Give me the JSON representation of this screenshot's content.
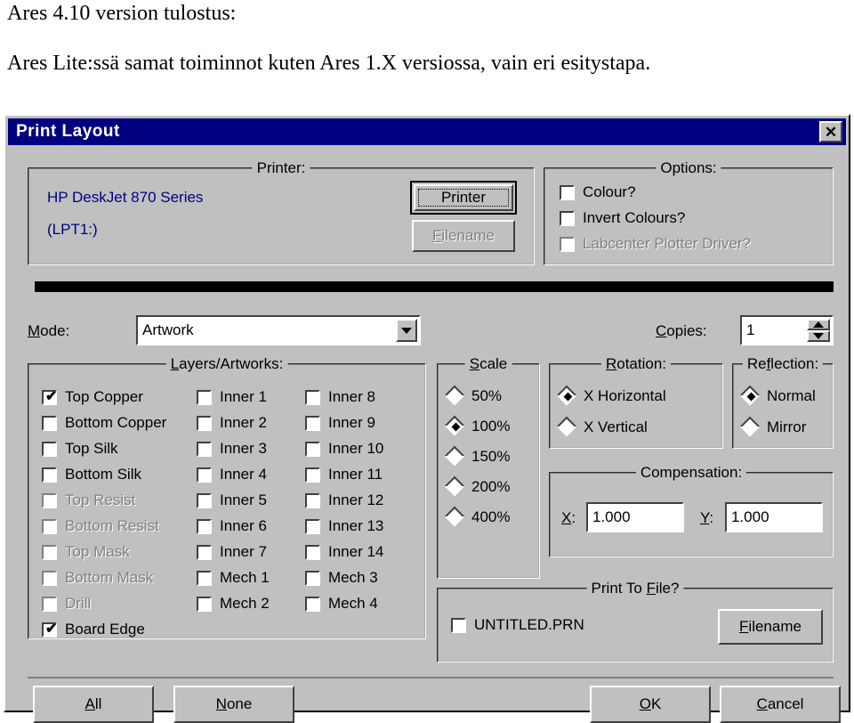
{
  "document": {
    "line1": "Ares 4.10 version tulostus:",
    "line2": "Ares Lite:ssä samat toiminnot kuten Ares 1.X versiossa, vain eri esitystapa."
  },
  "dialog": {
    "title": "Print Layout",
    "close_icon": "close-icon",
    "close_label": "✕",
    "colors": {
      "titlebar": "#000080",
      "face": "#c0c0c0",
      "printer_text": "#000080",
      "disabled_text": "#808080"
    },
    "printer_group": {
      "label": "Printer:",
      "name_line": "HP DeskJet 870 Series",
      "port_line": "(LPT1:)",
      "printer_button": "Printer",
      "filename_button": "Filename",
      "filename_button_accel": "F"
    },
    "options_group": {
      "label": "Options:",
      "items": [
        {
          "label": "Colour?",
          "checked": false,
          "disabled": false
        },
        {
          "label": "Invert Colours?",
          "checked": false,
          "disabled": false
        },
        {
          "label": "Labcenter Plotter Driver?",
          "checked": false,
          "disabled": true
        }
      ]
    },
    "mode_row": {
      "label": "Mode:",
      "label_accel": "M",
      "value": "Artwork",
      "options": [
        "Artwork"
      ]
    },
    "copies_row": {
      "label": "Copies:",
      "label_accel": "C",
      "value": "1"
    },
    "layers_group": {
      "label": "Layers/Artworks:",
      "label_accel": "L",
      "column1": [
        {
          "label": "Top Copper",
          "checked": true,
          "disabled": false
        },
        {
          "label": "Bottom Copper",
          "checked": false,
          "disabled": false
        },
        {
          "label": "Top Silk",
          "checked": false,
          "disabled": false
        },
        {
          "label": "Bottom Silk",
          "checked": false,
          "disabled": false
        },
        {
          "label": "Top Resist",
          "checked": false,
          "disabled": true
        },
        {
          "label": "Bottom Resist",
          "checked": false,
          "disabled": true
        },
        {
          "label": "Top Mask",
          "checked": false,
          "disabled": true
        },
        {
          "label": "Bottom Mask",
          "checked": false,
          "disabled": true
        },
        {
          "label": "Drill",
          "checked": false,
          "disabled": true
        },
        {
          "label": "Board Edge",
          "checked": true,
          "disabled": false
        }
      ],
      "column2": [
        {
          "label": "Inner 1",
          "checked": false,
          "disabled": false
        },
        {
          "label": "Inner 2",
          "checked": false,
          "disabled": false
        },
        {
          "label": "Inner 3",
          "checked": false,
          "disabled": false
        },
        {
          "label": "Inner 4",
          "checked": false,
          "disabled": false
        },
        {
          "label": "Inner 5",
          "checked": false,
          "disabled": false
        },
        {
          "label": "Inner 6",
          "checked": false,
          "disabled": false
        },
        {
          "label": "Inner 7",
          "checked": false,
          "disabled": false
        },
        {
          "label": "Mech 1",
          "checked": false,
          "disabled": false
        },
        {
          "label": "Mech 2",
          "checked": false,
          "disabled": false
        }
      ],
      "column3": [
        {
          "label": "Inner 8",
          "checked": false,
          "disabled": false
        },
        {
          "label": "Inner 9",
          "checked": false,
          "disabled": false
        },
        {
          "label": "Inner 10",
          "checked": false,
          "disabled": false
        },
        {
          "label": "Inner 11",
          "checked": false,
          "disabled": false
        },
        {
          "label": "Inner 12",
          "checked": false,
          "disabled": false
        },
        {
          "label": "Inner 13",
          "checked": false,
          "disabled": false
        },
        {
          "label": "Inner 14",
          "checked": false,
          "disabled": false
        },
        {
          "label": "Mech 3",
          "checked": false,
          "disabled": false
        },
        {
          "label": "Mech 4",
          "checked": false,
          "disabled": false
        }
      ],
      "all_button": "All",
      "all_button_accel": "A",
      "none_button": "None",
      "none_button_accel": "N"
    },
    "scale_group": {
      "label": "Scale",
      "label_accel": "S",
      "options": [
        {
          "label": "50%",
          "selected": false
        },
        {
          "label": "100%",
          "selected": true
        },
        {
          "label": "150%",
          "selected": false
        },
        {
          "label": "200%",
          "selected": false
        },
        {
          "label": "400%",
          "selected": false
        }
      ]
    },
    "rotation_group": {
      "label": "Rotation:",
      "label_accel": "R",
      "options": [
        {
          "label": "X Horizontal",
          "selected": true
        },
        {
          "label": "X Vertical",
          "selected": false
        }
      ]
    },
    "reflection_group": {
      "label": "Reflection:",
      "label_accel": "f",
      "options": [
        {
          "label": "Normal",
          "selected": true
        },
        {
          "label": "Mirror",
          "selected": false
        }
      ]
    },
    "compensation_group": {
      "label": "Compensation:",
      "x_label": "X:",
      "x_value": "1.000",
      "y_label": "Y:",
      "y_value": "1.000"
    },
    "print_to_file_group": {
      "label": "Print To File?",
      "label_accel": "F",
      "checkbox_label": "UNTITLED.PRN",
      "checkbox_checked": false,
      "filename_button": "Filename",
      "filename_button_accel": "F"
    },
    "footer": {
      "ok_button": "OK",
      "ok_button_accel": "O",
      "cancel_button": "Cancel",
      "cancel_button_accel": "C"
    }
  }
}
